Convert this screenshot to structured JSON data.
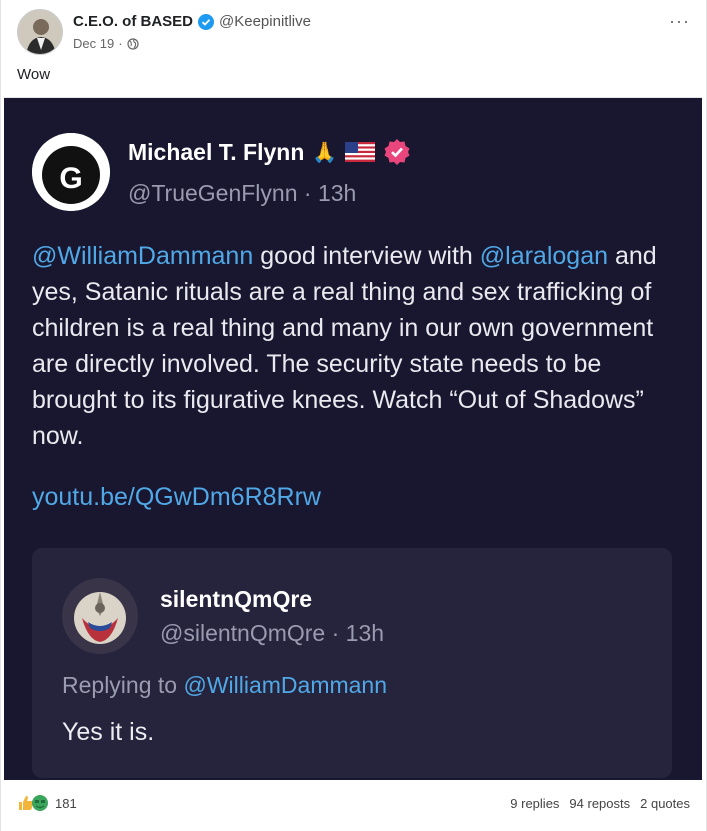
{
  "post": {
    "author": {
      "display_name": "C.E.O. of BASED",
      "handle": "@Keepinitlive",
      "verified": true
    },
    "date": "Dec 19",
    "separator": "·",
    "visibility_icon": "globe-icon",
    "more_label": "···",
    "text": "Wow"
  },
  "embedded_tweet": {
    "author_name": "Michael T. Flynn",
    "emoji": "🙏",
    "author_handle_line": "@TrueGenFlynn · 13h",
    "body_mention_1": "@WilliamDammann",
    "body_text_1": " good interview with ",
    "body_mention_2": "@laralogan",
    "body_text_2": " and yes, Satanic rituals are a real thing and sex trafficking of children is a real thing and many in our own government are directly involved. The security state needs to be brought to its figurative knees. Watch “Out of Shadows” now.",
    "link": "youtu.be/QGwDm6R8Rrw",
    "quote": {
      "author_name": "silentnQmQre",
      "author_handle_line": "@silentnQmQre · 13h",
      "reply_prefix": "Replying to ",
      "reply_mention": "@WilliamDammann",
      "body": "Yes it is."
    }
  },
  "footer": {
    "reaction_count": "181",
    "replies": "9 replies",
    "reposts": "94 reposts",
    "quotes": "2 quotes"
  },
  "colors": {
    "media_bg": "#19162f",
    "quote_bg": "#26233c",
    "mention": "#50a8e6",
    "verified_blue": "#1d9bf0",
    "badge_pink": "#e8467c"
  }
}
